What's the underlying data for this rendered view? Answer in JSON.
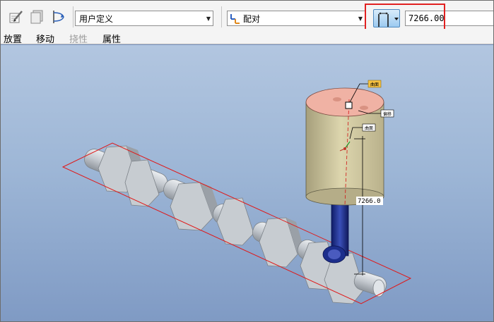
{
  "toolbar": {
    "placement_type": "用户定义",
    "constraint_type": "配对",
    "offset_value": "7266.00"
  },
  "tabs": [
    {
      "label": "放置",
      "enabled": true
    },
    {
      "label": "移动",
      "enabled": true
    },
    {
      "label": "挠性",
      "enabled": false
    },
    {
      "label": "属性",
      "enabled": true
    }
  ],
  "viewport": {
    "dimension_label": "7266.0",
    "tags": [
      "曲面",
      "偏移",
      "曲面"
    ]
  },
  "colors": {
    "highlight": "#e12121",
    "viewport_top": "#b2c6e0",
    "viewport_bottom": "#7f9ac4",
    "datum_plane": "#e01818",
    "piston_body": "#d8d0a6",
    "piston_top": "#f0b2a4",
    "rod": "#1c2e8c",
    "crankshaft": "#c7ccd1"
  },
  "icons": [
    "edit-constraint-icon",
    "copy-icon",
    "curve-placement-icon",
    "coordinate-system-icon",
    "offset-constraint-icon"
  ]
}
